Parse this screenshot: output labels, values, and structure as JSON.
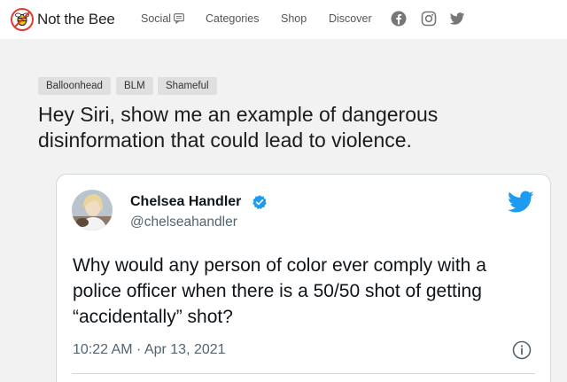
{
  "header": {
    "logo_text": "Not the Bee",
    "nav": {
      "social": "Social",
      "categories": "Categories",
      "shop": "Shop",
      "discover": "Discover"
    },
    "social_icons": [
      "facebook-icon",
      "instagram-icon",
      "twitter-icon"
    ]
  },
  "article": {
    "tags": [
      "Balloonhead",
      "BLM",
      "Shameful"
    ],
    "headline": "Hey Siri, show me an example of dangerous disinformation that could lead to violence."
  },
  "tweet": {
    "name": "Chelsea Handler",
    "handle": "@chelseahandler",
    "text": "Why would any person of color ever comply with a police officer when there is a 50/50 shot of getting “accidentally” shot?",
    "time": "10:22 AM · Apr 13, 2021"
  },
  "colors": {
    "page_bg": "#f2f2f2",
    "logo_red": "#e23b2e",
    "twitter_blue": "#1d9bf0",
    "tag_bg": "#dfdfdf"
  }
}
